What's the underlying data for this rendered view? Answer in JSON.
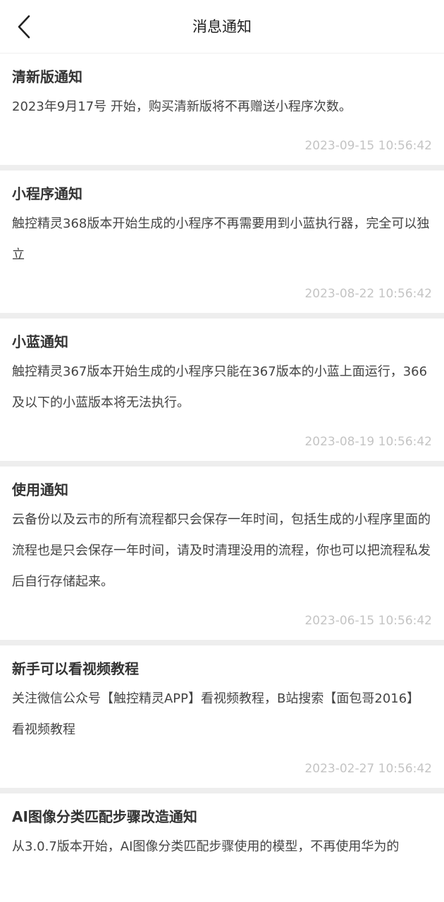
{
  "header": {
    "title": "消息通知",
    "back_icon": "chevron-left-icon"
  },
  "notifications": [
    {
      "title": "清新版通知",
      "body": "2023年9月17号 开始，购买清新版将不再赠送小程序次数。",
      "time": "2023-09-15 10:56:42"
    },
    {
      "title": "小程序通知",
      "body": "触控精灵368版本开始生成的小程序不再需要用到小蓝执行器，完全可以独立",
      "time": "2023-08-22 10:56:42"
    },
    {
      "title": "小蓝通知",
      "body": "触控精灵367版本开始生成的小程序只能在367版本的小蓝上面运行，366及以下的小蓝版本将无法执行。",
      "time": "2023-08-19 10:56:42"
    },
    {
      "title": "使用通知",
      "body": "云备份以及云市的所有流程都只会保存一年时间，包括生成的小程序里面的流程也是只会保存一年时间，请及时清理没用的流程，你也可以把流程私发后自行存储起来。",
      "time": "2023-06-15 10:56:42"
    },
    {
      "title": "新手可以看视频教程",
      "body": "关注微信公众号【触控精灵APP】看视频教程，B站搜索【面包哥2016】看视频教程",
      "time": "2023-02-27 10:56:42"
    },
    {
      "title": "AI图像分类匹配步骤改造通知",
      "body": "从3.0.7版本开始，AI图像分类匹配步骤使用的模型，不再使用华为的"
    }
  ]
}
